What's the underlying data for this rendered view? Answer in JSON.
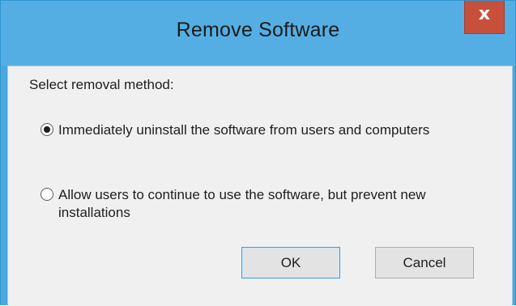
{
  "window": {
    "title": "Remove Software",
    "close_glyph": "x"
  },
  "dialog": {
    "prompt": "Select removal method:",
    "options": [
      {
        "label": "Immediately uninstall the software from users and computers",
        "selected": true
      },
      {
        "label": "Allow users to continue to use the software, but prevent new installations",
        "selected": false
      }
    ],
    "buttons": {
      "ok": "OK",
      "cancel": "Cancel"
    }
  },
  "colors": {
    "titlebar": "#55aee3",
    "close_button": "#c7503c",
    "client_background": "#f0f0f0"
  }
}
